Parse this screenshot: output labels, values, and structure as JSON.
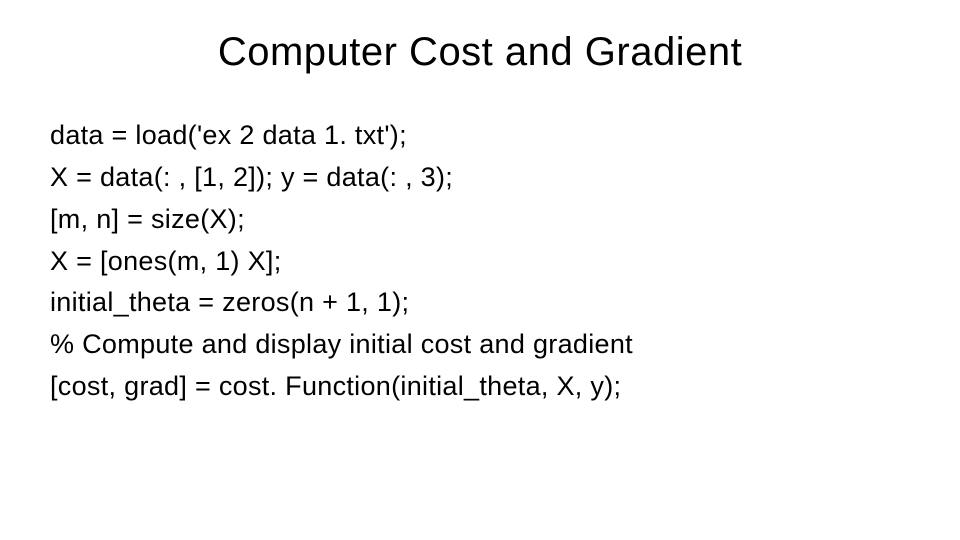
{
  "title": "Computer Cost and Gradient",
  "code": {
    "line1": "data = load('ex 2 data 1. txt');",
    "line2": "X = data(: , [1, 2]); y = data(: , 3);",
    "line3": "[m, n] = size(X);",
    "line4": "X = [ones(m, 1) X];",
    "line5": "initial_theta = zeros(n + 1, 1);",
    "line6": "% Compute and display initial cost and gradient",
    "line7": "[cost, grad] = cost. Function(initial_theta, X, y);"
  }
}
